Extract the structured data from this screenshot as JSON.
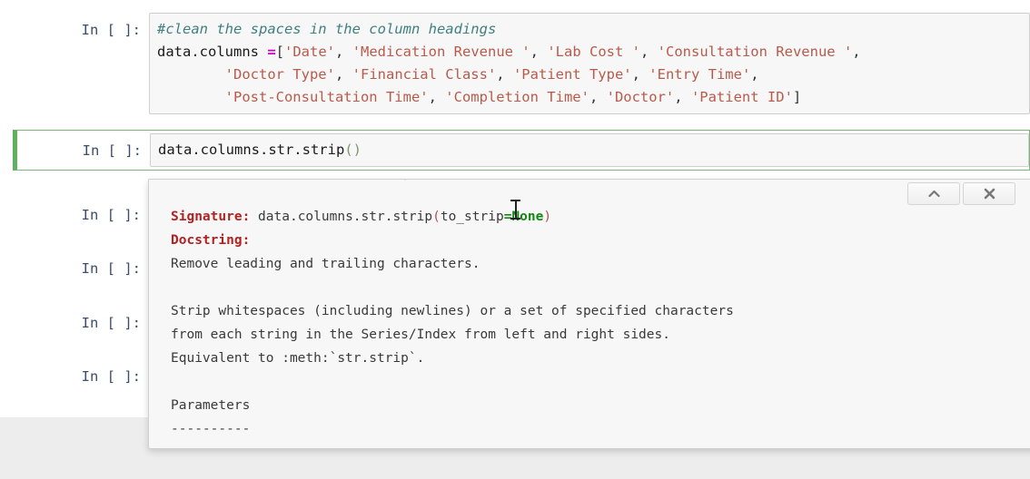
{
  "app": {
    "name": "jupyter-notebook"
  },
  "cells": [
    {
      "prompt": "In [ ]:",
      "type": "code",
      "lines": [
        [
          {
            "t": "#clean the spaces in the column headings",
            "c": "cmt"
          }
        ],
        [
          {
            "t": "data.columns ",
            "c": "plain"
          },
          {
            "t": "=",
            "c": "op"
          },
          {
            "t": "[",
            "c": "punc"
          },
          {
            "t": "'Date'",
            "c": "str"
          },
          {
            "t": ", ",
            "c": "punc"
          },
          {
            "t": "'Medication Revenue '",
            "c": "str"
          },
          {
            "t": ", ",
            "c": "punc"
          },
          {
            "t": "'Lab Cost '",
            "c": "str"
          },
          {
            "t": ", ",
            "c": "punc"
          },
          {
            "t": "'Consultation Revenue '",
            "c": "str"
          },
          {
            "t": ",",
            "c": "punc"
          }
        ],
        [
          {
            "t": "        ",
            "c": "plain"
          },
          {
            "t": "'Doctor Type'",
            "c": "str"
          },
          {
            "t": ", ",
            "c": "punc"
          },
          {
            "t": "'Financial Class'",
            "c": "str"
          },
          {
            "t": ", ",
            "c": "punc"
          },
          {
            "t": "'Patient Type'",
            "c": "str"
          },
          {
            "t": ", ",
            "c": "punc"
          },
          {
            "t": "'Entry Time'",
            "c": "str"
          },
          {
            "t": ",",
            "c": "punc"
          }
        ],
        [
          {
            "t": "        ",
            "c": "plain"
          },
          {
            "t": "'Post-Consultation Time'",
            "c": "str"
          },
          {
            "t": ", ",
            "c": "punc"
          },
          {
            "t": "'Completion Time'",
            "c": "str"
          },
          {
            "t": ", ",
            "c": "punc"
          },
          {
            "t": "'Doctor'",
            "c": "str"
          },
          {
            "t": ", ",
            "c": "punc"
          },
          {
            "t": "'Patient ID'",
            "c": "str"
          },
          {
            "t": "]",
            "c": "punc"
          }
        ]
      ]
    }
  ],
  "selected_cell": {
    "prompt": "In [ ]:",
    "code_plain": "data.columns.str.strip",
    "code_parens": "()",
    "selection_color": "#60b060"
  },
  "empty_cells": [
    {
      "prompt": "In [ ]:"
    },
    {
      "prompt": "In [ ]:"
    },
    {
      "prompt": "In [ ]:"
    },
    {
      "prompt": "In [ ]:"
    }
  ],
  "tooltip": {
    "buttons": [
      {
        "name": "expand-up-button",
        "icon": "chevron-up-icon",
        "label": "▲"
      },
      {
        "name": "close-button",
        "icon": "close-x-icon",
        "label": "✖"
      }
    ],
    "scrollbar": {
      "up_arrow": "▲",
      "down_arrow": "▼"
    },
    "doc": {
      "signature_label": "Signature:",
      "signature_name": " data.columns.str.strip",
      "signature_open": "(",
      "signature_param": "to_strip",
      "signature_eq": "=",
      "signature_default": "None",
      "signature_close": ")",
      "docstring_label": "Docstring:",
      "body_lines": [
        "Remove leading and trailing characters.",
        "",
        "Strip whitespaces (including newlines) or a set of specified characters",
        "from each string in the Series/Index from left and right sides.",
        "Equivalent to :meth:`str.strip`.",
        "",
        "Parameters",
        "----------"
      ]
    }
  }
}
